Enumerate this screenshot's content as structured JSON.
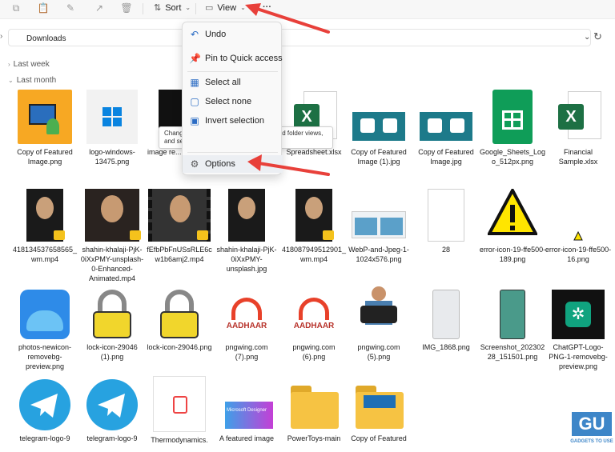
{
  "toolbar": {
    "sort_label": "Sort",
    "view_label": "View",
    "more_label": "···"
  },
  "address": {
    "path": "Downloads"
  },
  "groups": {
    "last_week": "Last week",
    "last_month": "Last month"
  },
  "menu": {
    "undo": "Undo",
    "pin": "Pin to Quick access",
    "select_all": "Select all",
    "select_none": "Select none",
    "invert": "Invert selection",
    "options": "Options"
  },
  "tooltip": "Change settings for opening items, file and folder views, and search.",
  "files": {
    "r1": [
      "Copy of Featured Image.png",
      "logo-windows-13475.png",
      "image re... -previe...",
      "Spreadsheet.xlsx",
      "Copy of Featured Image (1).jpg",
      "Copy of Featured Image.jpg",
      "Google_Sheets_Logo_512px.png",
      "Financial Sample.xlsx"
    ],
    "r2": [
      "418134537658565_wm.mp4",
      "shahin-khalaji-PjK-0iXxPMY-unsplash-0-Enhanced-Animated.mp4",
      "fEfbPbFnUSsRLE6cw1b6amj2.mp4",
      "shahin-khalaji-PjK-0iXxPMY-unsplash.jpg",
      "418087949512901_wm.mp4",
      "WebP-and-Jpeg-1-1024x576.png",
      "28",
      "error-icon-19-ffe500-189.png",
      "error-icon-19-ffe500-16.png"
    ],
    "r3": [
      "photos-newicon-removebg-preview.png",
      "lock-icon-29046 (1).png",
      "lock-icon-29046.png",
      "pngwing.com (7).png",
      "pngwing.com (6).png",
      "pngwing.com (5).png",
      "IMG_1868.png",
      "Screenshot_20230228_151501.png",
      "ChatGPT-Logo-PNG-1-removebg-preview.png"
    ],
    "r4": [
      "telegram-logo-9",
      "telegram-logo-9",
      "Thermodynamics.",
      "A featured image",
      "PowerToys-main",
      "Copy of Featured"
    ]
  },
  "thumb_text": {
    "aadhaar": "AADHAAR",
    "excel_x": "X",
    "gl": "GADGETS TO USE",
    "design": "Microsoft Designer"
  },
  "colors": {
    "accent": "#0078d4",
    "arrow": "#e8403a",
    "excel": "#1d7044",
    "sheets": "#0f9d58",
    "folder": "#f6c343"
  }
}
